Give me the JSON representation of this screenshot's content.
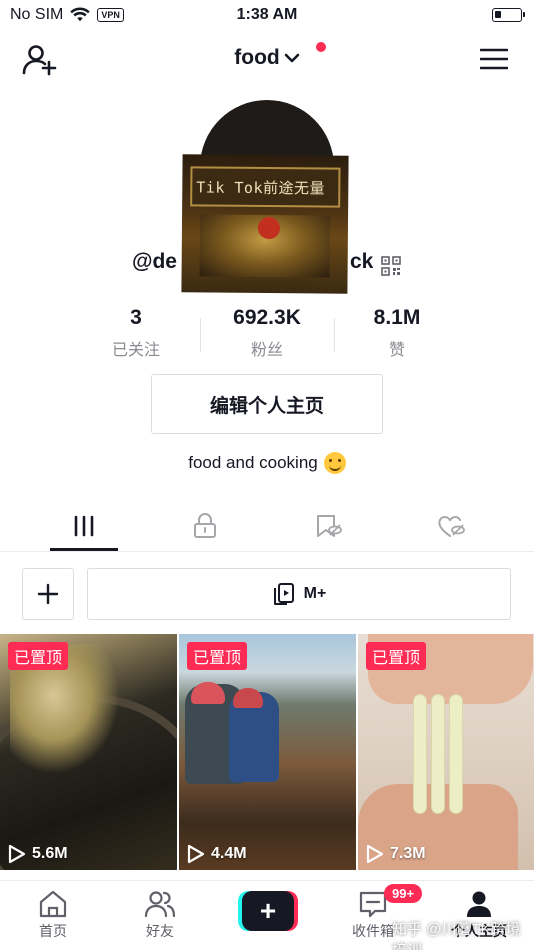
{
  "status_bar": {
    "carrier": "No SIM",
    "vpn": "VPN",
    "time": "1:38 AM"
  },
  "header": {
    "title": "food"
  },
  "avatar": {
    "caption": "Tik Tok前途无量"
  },
  "profile": {
    "username_left": "@de",
    "username_right": "ck"
  },
  "stats": [
    {
      "value": "3",
      "label": "已关注"
    },
    {
      "value": "692.3K",
      "label": "粉丝"
    },
    {
      "value": "8.1M",
      "label": "赞"
    }
  ],
  "edit_button": "编辑个人主页",
  "bio": "food and cooking",
  "action_row": {
    "add_label": "+",
    "m_label": "M+"
  },
  "videos": [
    {
      "badge": "已置顶",
      "views": "5.6M"
    },
    {
      "badge": "已置顶",
      "views": "4.4M"
    },
    {
      "badge": "已置顶",
      "views": "7.3M"
    }
  ],
  "nav": {
    "home": "首页",
    "friends": "好友",
    "inbox": "收件箱",
    "inbox_badge": "99+",
    "profile": "个人主页"
  },
  "watermark": "知乎 @川蘑TK跨境培训",
  "colors": {
    "accent": "#fe2c55",
    "cyan": "#25f4ee",
    "text": "#161823",
    "muted": "#8a8b91"
  }
}
